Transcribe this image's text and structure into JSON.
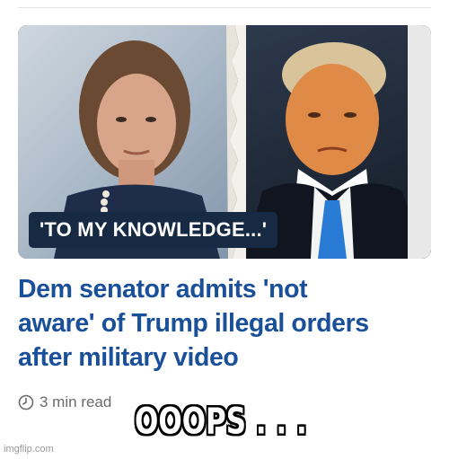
{
  "article": {
    "image_overlay": "'TO MY KNOWLEDGE...'",
    "headline_lines": [
      "Dem senator admits 'not",
      "aware' of Trump illegal orders",
      "after military video"
    ],
    "read_time": "3 min read"
  },
  "meme": {
    "caption": "OOOPS . . ."
  },
  "watermark": {
    "text": "imgflip.com"
  },
  "colors": {
    "headline": "#1a4f99",
    "overlay_bg": "#162a44",
    "meta_text": "#6b6b6b"
  },
  "icons": [
    "clock-icon"
  ]
}
